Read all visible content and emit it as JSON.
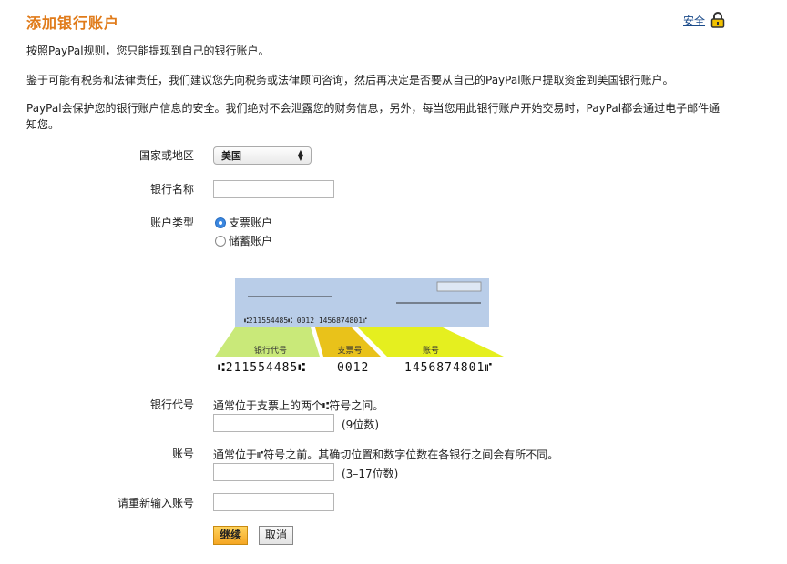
{
  "page": {
    "title": "添加银行账户",
    "security_link": "安全",
    "paragraphs": [
      "按照PayPal规则，您只能提现到自己的银行账户。",
      "鉴于可能有税务和法律责任，我们建议您先向税务或法律顾问咨询，然后再决定是否要从自己的PayPal账户提取资金到美国银行账户。",
      "PayPal会保护您的银行账户信息的安全。我们绝对不会泄露您的财务信息，另外，每当您用此银行账户开始交易时，PayPal都会通过电子邮件通知您。"
    ]
  },
  "form": {
    "country_label": "国家或地区",
    "country_value": "美国",
    "bank_name_label": "银行名称",
    "bank_name_value": "",
    "account_type_label": "账户类型",
    "account_types": [
      {
        "label": "支票账户",
        "checked": true
      },
      {
        "label": "储蓄账户",
        "checked": false
      }
    ],
    "routing_label": "银行代号",
    "routing_hint": "通常位于支票上的两个⑆符号之间。",
    "routing_digits": "(9位数)",
    "routing_value": "",
    "account_label": "账号",
    "account_hint": "通常位于⑈符号之前。其确切位置和数字位数在各银行之间会有所不同。",
    "account_digits": "(3–17位数)",
    "account_value": "",
    "reenter_label": "请重新输入账号",
    "reenter_value": ""
  },
  "check_image": {
    "micr_line_small": "⑆211554485⑆  0012   1456874801⑈",
    "routing_tag": "银行代号",
    "check_tag": "支票号",
    "account_tag": "账号",
    "routing_number": "⑆211554485⑆",
    "check_number": "0012",
    "account_number": "1456874801⑈",
    "colors": {
      "check_bg": "#b9cde8",
      "routing_band": "#c9e979",
      "check_band": "#e9c21a",
      "account_band": "#e5ef1f"
    }
  },
  "buttons": {
    "continue": "继续",
    "cancel": "取消"
  }
}
